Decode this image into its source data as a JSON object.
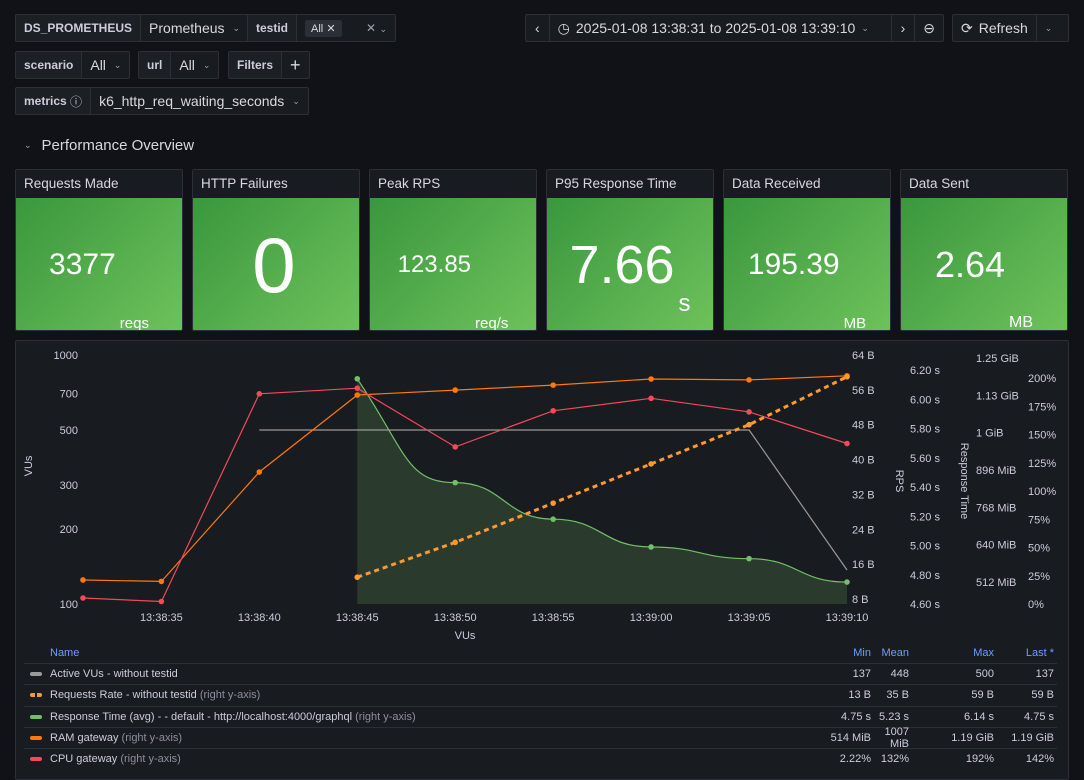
{
  "vars": {
    "datasource": {
      "label": "DS_PROMETHEUS",
      "value": "Prometheus"
    },
    "testid": {
      "label": "testid",
      "chip": "All"
    },
    "scenario": {
      "label": "scenario",
      "value": "All"
    },
    "url": {
      "label": "url",
      "value": "All"
    },
    "filters": {
      "label": "Filters",
      "add": "+"
    },
    "metrics": {
      "label": "metrics",
      "value": "k6_http_req_waiting_seconds"
    }
  },
  "timepicker": {
    "range": "2025-01-08 13:38:31 to 2025-01-08 13:39:10",
    "refresh": "Refresh"
  },
  "section": {
    "title": "Performance Overview"
  },
  "stats": [
    {
      "title": "Requests Made",
      "value": "3377",
      "unit": "reqs"
    },
    {
      "title": "HTTP Failures",
      "value": "0",
      "unit": ""
    },
    {
      "title": "Peak RPS",
      "value": "123.85",
      "unit": "req/s"
    },
    {
      "title": "P95 Response Time",
      "value": "7.66",
      "unit": "s"
    },
    {
      "title": "Data Received",
      "value": "195.39",
      "unit": "MB"
    },
    {
      "title": "Data Sent",
      "value": "2.64",
      "unit": "MB"
    }
  ],
  "colors": {
    "stat_green": "#56a64b",
    "gray": "#9a9a9a",
    "orange_dash": "#ff9830",
    "green": "#73bf69",
    "orange": "#ff780a",
    "red": "#f2495c"
  },
  "chart_data": {
    "type": "line",
    "xlabel": "VUs",
    "xticks": [
      "13:38:35",
      "13:38:40",
      "13:38:45",
      "13:38:50",
      "13:38:55",
      "13:39:00",
      "13:39:05",
      "13:39:10"
    ],
    "xlim": [
      "13:38:31",
      "13:39:10"
    ],
    "axes": {
      "vus": {
        "label": "VUs",
        "scale": "log",
        "range": [
          100,
          1000
        ],
        "ticks": [
          "100",
          "200",
          "300",
          "500",
          "700",
          "1000"
        ],
        "tickvals": [
          100,
          200,
          300,
          500,
          700,
          1000
        ]
      },
      "bytes": {
        "label": "RPS",
        "range": [
          8,
          64
        ],
        "ticks": [
          "8 B",
          "16 B",
          "24 B",
          "32 B",
          "40 B",
          "48 B",
          "56 B",
          "64 B"
        ],
        "tickvals": [
          8,
          16,
          24,
          32,
          40,
          48,
          56,
          64
        ]
      },
      "seconds": {
        "label": "Response Time",
        "range": [
          4.6,
          6.2
        ],
        "ticks": [
          "4.60 s",
          "4.80 s",
          "5.00 s",
          "5.20 s",
          "5.40 s",
          "5.60 s",
          "5.80 s",
          "6.00 s",
          "6.20 s"
        ],
        "tickvals": [
          4.6,
          4.8,
          5.0,
          5.2,
          5.4,
          5.6,
          5.8,
          6.0,
          6.2
        ]
      },
      "mib": {
        "label": "",
        "range": [
          512,
          1280
        ],
        "ticks": [
          "512 MiB",
          "640 MiB",
          "768 MiB",
          "896 MiB",
          "1 GiB",
          "1.13 GiB",
          "1.25 GiB"
        ],
        "tickvals": [
          512,
          640,
          768,
          896,
          1024,
          1152,
          1280
        ]
      },
      "percent": {
        "label": "",
        "range": [
          0,
          200
        ],
        "ticks": [
          "0%",
          "25%",
          "50%",
          "75%",
          "100%",
          "125%",
          "150%",
          "175%",
          "200%"
        ],
        "tickvals": [
          0,
          25,
          50,
          75,
          100,
          125,
          150,
          175,
          200
        ]
      }
    },
    "series": [
      {
        "name": "Active VUs - without testid",
        "axis": "vus",
        "color": "#9a9a9a",
        "style": "solid",
        "x": [
          "13:38:40",
          "13:39:05",
          "13:39:10"
        ],
        "y": [
          500,
          500,
          137
        ],
        "points": false
      },
      {
        "name": "Requests Rate - without testid",
        "hint": "(right y-axis)",
        "axis": "bytes",
        "color": "#ff9830",
        "style": "dashed",
        "x": [
          "13:38:45",
          "13:38:50",
          "13:38:55",
          "13:39:00",
          "13:39:05",
          "13:39:10"
        ],
        "y": [
          13,
          21,
          30,
          39,
          48,
          59
        ],
        "points": true
      },
      {
        "name": "Response Time (avg) - - default - http://localhost:4000/graphql",
        "hint": "(right y-axis)",
        "axis": "seconds",
        "color": "#73bf69",
        "style": "fill",
        "x": [
          "13:38:45",
          "13:38:50",
          "13:38:55",
          "13:39:00",
          "13:39:05",
          "13:39:10"
        ],
        "y": [
          6.14,
          5.43,
          5.18,
          4.99,
          4.91,
          4.75
        ],
        "points": true
      },
      {
        "name": "RAM gateway",
        "hint": "(right y-axis)",
        "axis": "mib",
        "color": "#ff780a",
        "style": "solid",
        "x": [
          "13:38:31",
          "13:38:35",
          "13:38:40",
          "13:38:45",
          "13:38:50",
          "13:38:55",
          "13:39:00",
          "13:39:05",
          "13:39:10"
        ],
        "y": [
          519,
          514,
          889,
          1153,
          1170,
          1187,
          1208,
          1205,
          1219
        ],
        "points": true
      },
      {
        "name": "CPU gateway",
        "hint": "(right y-axis)",
        "axis": "percent",
        "color": "#f2495c",
        "style": "solid",
        "x": [
          "13:38:31",
          "13:38:35",
          "13:38:40",
          "13:38:45",
          "13:38:50",
          "13:38:55",
          "13:39:00",
          "13:39:05",
          "13:39:10"
        ],
        "y": [
          5.3,
          2.22,
          186,
          191,
          139,
          171,
          182,
          170,
          142
        ],
        "points": true
      }
    ]
  },
  "legend": {
    "headers": {
      "name": "Name",
      "min": "Min",
      "mean": "Mean",
      "max": "Max",
      "last": "Last *"
    },
    "rows": [
      {
        "name": "Active VUs - without testid",
        "hint": "",
        "min": "137",
        "mean": "448",
        "max": "500",
        "last": "137"
      },
      {
        "name": "Requests Rate - without testid",
        "hint": "(right y-axis)",
        "min": "13 B",
        "mean": "35 B",
        "max": "59 B",
        "last": "59 B"
      },
      {
        "name": "Response Time (avg) - - default - http://localhost:4000/graphql",
        "hint": "(right y-axis)",
        "min": "4.75 s",
        "mean": "5.23 s",
        "max": "6.14 s",
        "last": "4.75 s"
      },
      {
        "name": "RAM gateway",
        "hint": "(right y-axis)",
        "min": "514 MiB",
        "mean": "1007 MiB",
        "max": "1.19 GiB",
        "last": "1.19 GiB"
      },
      {
        "name": "CPU gateway",
        "hint": "(right y-axis)",
        "min": "2.22%",
        "mean": "132%",
        "max": "192%",
        "last": "142%"
      }
    ]
  }
}
